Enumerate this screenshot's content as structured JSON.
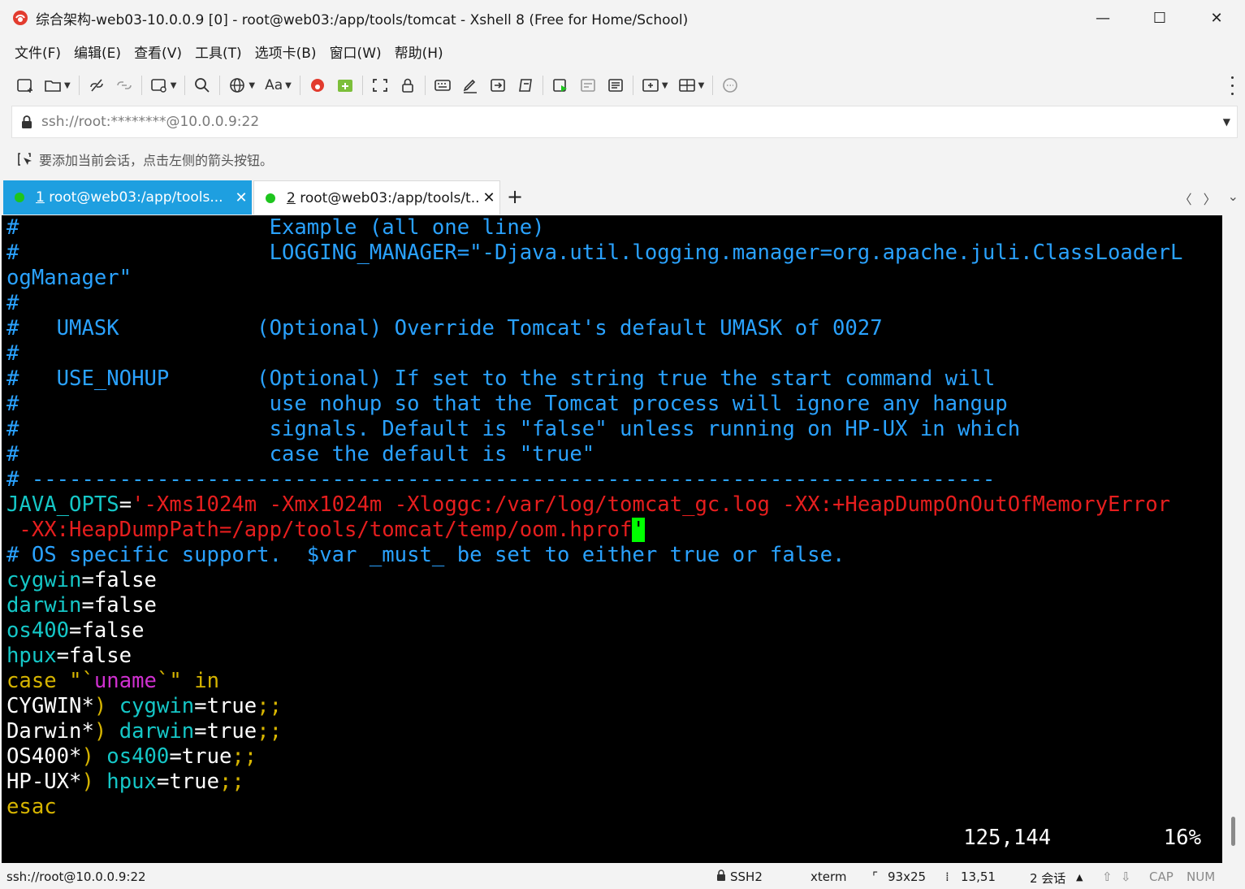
{
  "window": {
    "title": "综合架构-web03-10.0.0.9 [0] - root@web03:/app/tools/tomcat - Xshell 8 (Free for Home/School)",
    "minimize": "—",
    "maximize": "☐",
    "close": "✕"
  },
  "menu": [
    "文件(F)",
    "编辑(E)",
    "查看(V)",
    "工具(T)",
    "选项卡(B)",
    "窗口(W)",
    "帮助(H)"
  ],
  "toolbar": {
    "font_button": "Aa"
  },
  "address": {
    "value": "ssh://root:********@10.0.0.9:22"
  },
  "hint": {
    "text": "要添加当前会话，点击左侧的箭头按钮。"
  },
  "tabs": [
    {
      "number": "1",
      "label": "root@web03:/app/tools...",
      "active": true
    },
    {
      "number": "2",
      "label": "root@web03:/app/tools/t...",
      "active": false
    }
  ],
  "terminal": {
    "lines": [
      [
        [
          "c-blue",
          "#                    Example (all one line)"
        ]
      ],
      [
        [
          "c-blue",
          "#                    LOGGING_MANAGER=\"-Djava.util.logging.manager=org.apache.juli.ClassLoaderL"
        ]
      ],
      [
        [
          "c-blue",
          "ogManager\""
        ]
      ],
      [
        [
          "c-blue",
          "#"
        ]
      ],
      [
        [
          "c-blue",
          "#   UMASK           (Optional) Override Tomcat's default UMASK of 0027"
        ]
      ],
      [
        [
          "c-blue",
          "#"
        ]
      ],
      [
        [
          "c-blue",
          "#   USE_NOHUP       (Optional) If set to the string true the start command will"
        ]
      ],
      [
        [
          "c-blue",
          "#                    use nohup so that the Tomcat process will ignore any hangup"
        ]
      ],
      [
        [
          "c-blue",
          "#                    signals. Default is \"false\" unless running on HP-UX in which"
        ]
      ],
      [
        [
          "c-blue",
          "#                    case the default is \"true\""
        ]
      ],
      [
        [
          "c-blue",
          "# -----------------------------------------------------------------------------"
        ]
      ],
      [
        [
          "c-cyan",
          "JAVA_OPTS"
        ],
        [
          "c-white",
          "="
        ],
        [
          "c-red",
          "'-Xms1024m -Xmx1024m -Xloggc:/var/log/tomcat_gc.log -XX:+HeapDumpOnOutOfMemoryError"
        ]
      ],
      [
        [
          "c-red",
          " -XX:HeapDumpPath=/app/tools/tomcat/temp/oom.hprof"
        ],
        [
          "cursor",
          "'"
        ]
      ],
      [
        [
          "c-blue",
          "# OS specific support.  $var _must_ be set to either true or false."
        ]
      ],
      [
        [
          "c-cyan",
          "cygwin"
        ],
        [
          "c-white",
          "=false"
        ]
      ],
      [
        [
          "c-cyan",
          "darwin"
        ],
        [
          "c-white",
          "=false"
        ]
      ],
      [
        [
          "c-cyan",
          "os400"
        ],
        [
          "c-white",
          "=false"
        ]
      ],
      [
        [
          "c-cyan",
          "hpux"
        ],
        [
          "c-white",
          "=false"
        ]
      ],
      [
        [
          "c-yellow",
          "case"
        ],
        [
          "c-white",
          " "
        ],
        [
          "c-yellow",
          "\"`"
        ],
        [
          "c-magenta",
          "uname"
        ],
        [
          "c-yellow",
          "`\""
        ],
        [
          "c-white",
          " "
        ],
        [
          "c-yellow",
          "in"
        ]
      ],
      [
        [
          "c-white",
          "CYGWIN*"
        ],
        [
          "c-yellow",
          ")"
        ],
        [
          "c-white",
          " "
        ],
        [
          "c-cyan",
          "cygwin"
        ],
        [
          "c-white",
          "=true"
        ],
        [
          "c-yellow",
          ";;"
        ]
      ],
      [
        [
          "c-white",
          "Darwin*"
        ],
        [
          "c-yellow",
          ")"
        ],
        [
          "c-white",
          " "
        ],
        [
          "c-cyan",
          "darwin"
        ],
        [
          "c-white",
          "=true"
        ],
        [
          "c-yellow",
          ";;"
        ]
      ],
      [
        [
          "c-white",
          "OS400*"
        ],
        [
          "c-yellow",
          ")"
        ],
        [
          "c-white",
          " "
        ],
        [
          "c-cyan",
          "os400"
        ],
        [
          "c-white",
          "=true"
        ],
        [
          "c-yellow",
          ";;"
        ]
      ],
      [
        [
          "c-white",
          "HP-UX*"
        ],
        [
          "c-yellow",
          ")"
        ],
        [
          "c-white",
          " "
        ],
        [
          "c-cyan",
          "hpux"
        ],
        [
          "c-white",
          "=true"
        ],
        [
          "c-yellow",
          ";;"
        ]
      ],
      [
        [
          "c-yellow",
          "esac"
        ]
      ]
    ],
    "cursor_position": "125,144",
    "scroll_percent": "16%"
  },
  "statusbar": {
    "connection": "ssh://root@10.0.0.9:22",
    "protocol": "SSH2",
    "term_type": "xterm",
    "size": "93x25",
    "cursor": "13,51",
    "sessions": "2 会话",
    "cap": "CAP",
    "num": "NUM"
  },
  "colors": {
    "tab_active": "#1e9fe0",
    "terminal_bg": "#000000",
    "comment_blue": "#2aa2ff",
    "var_cyan": "#15c7c7",
    "string_red": "#e61e1e",
    "keyword_yellow": "#d6b400",
    "cursor_green": "#00ff00"
  }
}
